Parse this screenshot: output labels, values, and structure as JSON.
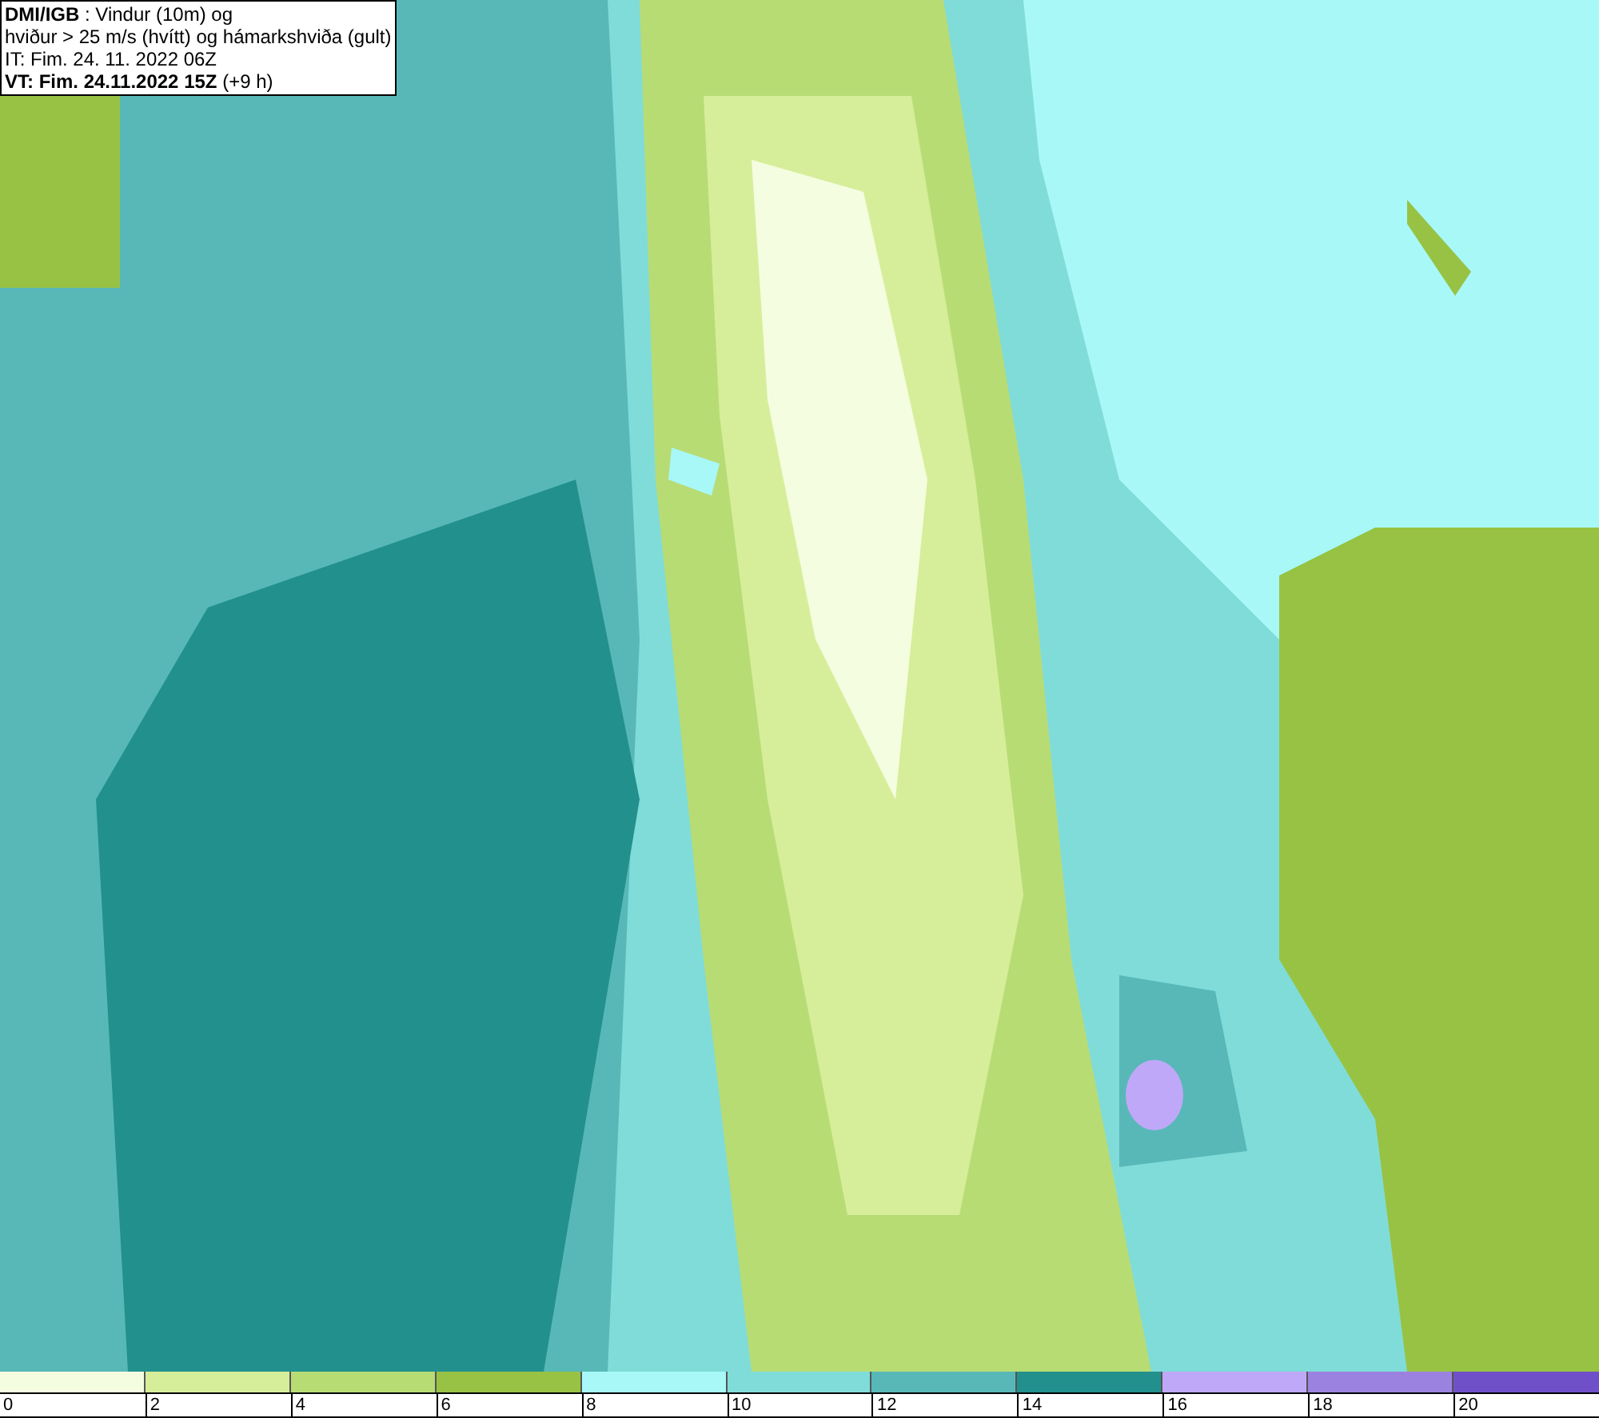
{
  "title_box": {
    "lines": [
      "**DMI/IGB** : Vindur (10m) og",
      "hviður > 25 m/s (hvítt) og hámarkshviða (gult)",
      "IT: Fim. 24. 11. 2022 06Z",
      "**VT: Fim. 24.11.2022 15Z** (+9 h)"
    ]
  },
  "legend": [
    {
      "label": "0",
      "color": "#f5fde0"
    },
    {
      "label": "2",
      "color": "#d6ee9a"
    },
    {
      "label": "4",
      "color": "#b8dc74"
    },
    {
      "label": "6",
      "color": "#98c244"
    },
    {
      "label": "8",
      "color": "#a8f8f8"
    },
    {
      "label": "10",
      "color": "#80dcd8"
    },
    {
      "label": "12",
      "color": "#58b8b8"
    },
    {
      "label": "14",
      "color": "#22908c"
    },
    {
      "label": "16",
      "color": "#c0a8f8"
    },
    {
      "label": "18",
      "color": "#9c82e0"
    },
    {
      "label": "20",
      "color": "#7050c8"
    }
  ]
}
